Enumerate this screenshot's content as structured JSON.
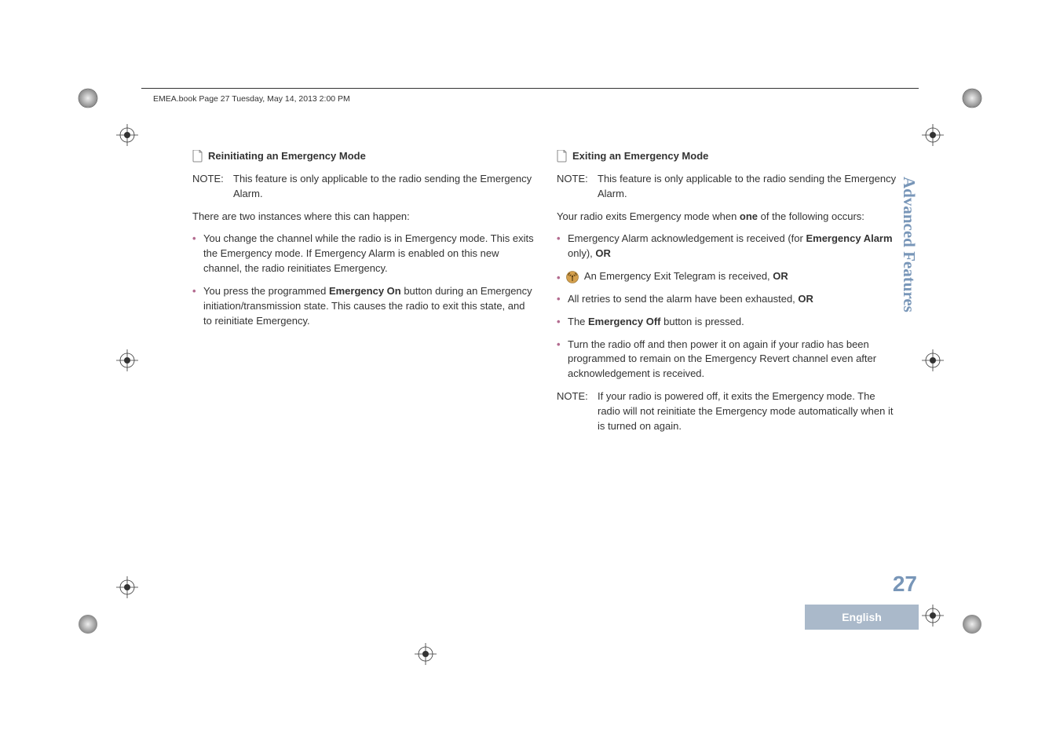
{
  "header": "EMEA.book  Page 27  Tuesday, May 14, 2013  2:00 PM",
  "sideTab": "Advanced Features",
  "pageNumber": "27",
  "language": "English",
  "left": {
    "title": "Reinitiating an Emergency Mode",
    "noteLabel": "NOTE:",
    "noteText": "This feature is only applicable to the radio sending the Emergency Alarm.",
    "para": "There are two instances where this can happen:",
    "bullet1": "You change the channel while the radio is in Emergency mode. This exits the Emergency mode. If Emergency Alarm is enabled on this new channel, the radio reinitiates Emergency.",
    "bullet2a": "You press the programmed ",
    "bullet2bold": "Emergency On",
    "bullet2b": " button during an Emergency initiation/transmission state. This causes the radio to exit this state, and to reinitiate Emergency."
  },
  "right": {
    "title": "Exiting an Emergency Mode",
    "noteLabel": "NOTE:",
    "noteText": "This feature is only applicable to the radio sending the Emergency Alarm.",
    "para1a": "Your radio exits Emergency mode when ",
    "para1bold": "one",
    "para1b": " of the following occurs:",
    "b1a": "Emergency Alarm acknowledgement is received (for ",
    "b1bold": "Emergency Alarm",
    "b1b": " only), ",
    "b1or": "OR",
    "b2a": " An Emergency Exit Telegram is received, ",
    "b2or": "OR",
    "b3a": "All retries to send the alarm have been exhausted, ",
    "b3or": "OR",
    "b4a": "The ",
    "b4bold": "Emergency Off",
    "b4b": " button is pressed.",
    "b5": "Turn the radio off and then power it on again if your radio has been programmed to remain on the Emergency Revert channel even after acknowledgement is received.",
    "note2Label": "NOTE:",
    "note2Text": "If your radio is powered off, it exits the Emergency mode. The radio will not reinitiate the Emergency mode automatically when it is turned on again."
  }
}
